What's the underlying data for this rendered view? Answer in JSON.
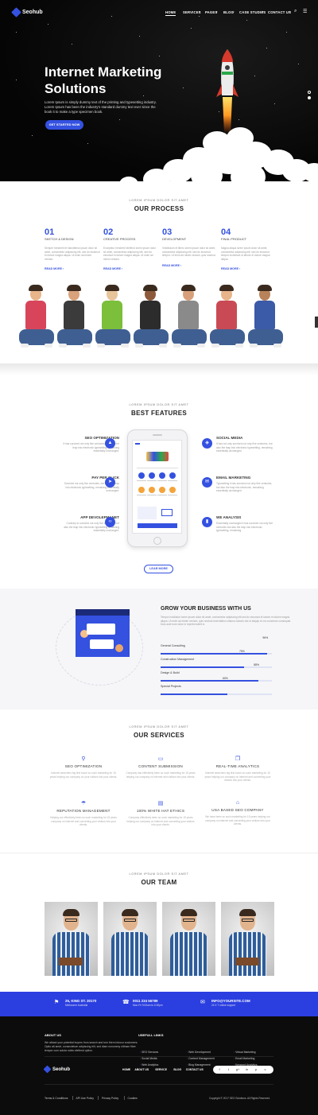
{
  "brand": {
    "name": "Seohub"
  },
  "nav": {
    "items": [
      "HOME",
      "SERVICES",
      "PAGES",
      "BLOG",
      "CASE STUDIES",
      "CONTACT US"
    ]
  },
  "hero": {
    "title_line1": "Internet Marketing",
    "title_line2": "Solutions",
    "text": "Lorem Ipsum is simply dummy text of the printing and typesetting industry. Lorem Ipsum has been the industry's standard dummy text ever since the book it to make a type specimen book.",
    "button": "GET STARTED NOW"
  },
  "process": {
    "eyebrow": "LOREM IPSUM DOLOR SIT AMET",
    "title": "OUR PROCESS",
    "steps": [
      {
        "num": "01",
        "label": "SKETCH & DESIGN",
        "text": "Semper hendrerit et blanditeros ipsum dolor sit amet, consectetur adipiscing elit, sed do eiusmod et dolore magna aliqua. Ut enim ad minim veniam.",
        "more": "READ MORE"
      },
      {
        "num": "02",
        "label": "CREATIVE PROCESS",
        "text": "Excepteur hendrerit eleifend lorem ipsum dolor sit amet, consectetur adipiscing elit, sed do eiusmod et dolore magna aliqua. Ut enim ad minim veniam.",
        "more": "READ MORE"
      },
      {
        "num": "03",
        "label": "DEVELOPMENT",
        "text": "Vestibulum et libero lorem ipsum dolor sit amet, consectetur adipiscing elit, sed do eiusmod tempor. Ut enim ad minim veniam, quis nostrud.",
        "more": "READ MORE"
      },
      {
        "num": "04",
        "label": "FINAL PRODUCT",
        "text": "Magna aliqua lorem ipsum dolor sit amet, consectetur adipiscing elit, sed do eiusmod tempor incididunt ut labore et dolore magna aliqua.",
        "more": "READ MORE"
      }
    ]
  },
  "features": {
    "eyebrow": "LOREM IPSUM DOLOR SIT AMET",
    "title": "BEST FEATURES",
    "left": [
      {
        "title": "SEO OPTIMIZATION",
        "text": "It has survived not only five centuries, but also the leap into electronic typesetting, remaining essentially unchanged.",
        "icon": "chart-icon"
      },
      {
        "title": "PAY PER CLICK",
        "text": "Survived not only five centuries, but also the leap into electronic typesetting, remaining essentially unchanged.",
        "icon": "cursor-icon"
      },
      {
        "title": "APP DEVOLEPMANET",
        "text": "Contrary to survived not only five centuries, but also the leap into electronic typesetting remaining essentially unchanged.",
        "icon": "code-icon"
      }
    ],
    "right": [
      {
        "title": "SOCIAL MEDIA",
        "text": "It has not only survived not only five centuries, but also the leap into electronic typesetting, remaining essentially unchanged.",
        "icon": "share-icon"
      },
      {
        "title": "EMAIL MARKETING",
        "text": "Typesetting it has survived not only five centuries, but also the leap into electronic, remaining essentially unchanged.",
        "icon": "mail-icon"
      },
      {
        "title": "WE ANALYSIS",
        "text": "Essentially unchanged it has survived not only five centuries but also the leap into electronic typesetting, remaining.",
        "icon": "bars-icon"
      }
    ],
    "button": "LEAR MORE"
  },
  "grow": {
    "title": "GROW YOUR BUSINESS WITH US",
    "text": "Tempor incididunt lorem ipsum dolor sit amet, consectetur adipiscing elit sed do eiusmod et labore et dolore magna aliqua. Ut enim ad minim veniam, quis nostrud exercitation ullamco laboris nisi ut aliquip ex ea commodo consequat. Duis aute irure dolor in reprehenderit in.",
    "skills": [
      {
        "label": "General Consulting",
        "pct": "96%",
        "value": 96
      },
      {
        "label": "Construction Management",
        "pct": "75%",
        "value": 75
      },
      {
        "label": "Design & Build",
        "pct": "88%",
        "value": 88
      },
      {
        "label": "Special Projects",
        "pct": "60%",
        "value": 60
      }
    ]
  },
  "services": {
    "eyebrow": "LOREM IPSUM DOLOR SIT AMET",
    "title": "OUR SERVICES",
    "items": [
      {
        "title": "SEO OPTIMIZATION",
        "text": "Internet searchers big first boom so such marketing for 15 years helping our company on your visitors into your clients.",
        "icon": "rocket-icon"
      },
      {
        "title": "CONTENT SUBMISSION",
        "text": "Company has effectively been so such marketing for 15 years helping our company on internet and visitors into your clients.",
        "icon": "monitor-icon"
      },
      {
        "title": "REAL-TIME ANALYTICS",
        "text": "Internet searchers big first boom so such marketing for 15 years helping our company on internet and converting your visitors into your clients.",
        "icon": "copy-icon"
      },
      {
        "title": "REPUTATION MANAGEMENT",
        "text": "Helping our effectively been so such marketing for 15 years company on internet and converting your visitors into your clients.",
        "icon": "umbrella-icon"
      },
      {
        "title": "100% WHITE HAT ETHICS",
        "text": "Company effectively been so such marketing for 15 years helping our company on internet and converting your visitors into your clients.",
        "icon": "document-icon"
      },
      {
        "title": "USA BASED SEO COMPANY",
        "text": "We have been so such marketing for 15 years helping our company on internet and converting your visitors into your clients.",
        "icon": "bank-icon"
      }
    ]
  },
  "team": {
    "eyebrow": "LOREM IPSUM DOLOR SIT AMET",
    "title": "OUR TEAM"
  },
  "contact": {
    "address": "25, KING ST. 20170",
    "address_sub": "Melbourne Australia",
    "phone": "0011 234 56789",
    "phone_sub": "Mon-Fri 9:00am to 6:30pm",
    "email": "INFO@YOURSITE.COM",
    "email_sub": "24 X 7 online support"
  },
  "footer": {
    "about_title": "ABOUT US",
    "about_text": "We attract your potential buyers from search and turn them intoour customers. Optio alt amet, consectetuer adipiscing elit, sed diam nonummy nibham fiber tempor cum soluta nobis eleifend option.",
    "links_title": "USEFULL LINKS",
    "links_col1": [
      "SEO Services",
      "Social Media",
      "Web Analytics"
    ],
    "links_col2": [
      "Web Development",
      "Content Management",
      "Blog Management"
    ],
    "links_col3": [
      "Virtual Marketing",
      "Email Marketing",
      "Keyword Analytics"
    ],
    "menu": [
      "HOME",
      "ABOUT US",
      "SERVICE",
      "BLOG",
      "CONTACT US"
    ],
    "social": [
      "f",
      "t",
      "g+",
      "in",
      "p",
      "v"
    ],
    "legal": [
      "Terms & Conditions",
      "API Use Policy",
      "Privacy Policy",
      "Cookies"
    ],
    "copyright": "Copyright © 2017 SEO Solutions. All Rights Reserved."
  },
  "colors": {
    "accent": "#3451e0",
    "dark": "#0c0c0c",
    "light_bg": "#f6f6f8"
  }
}
